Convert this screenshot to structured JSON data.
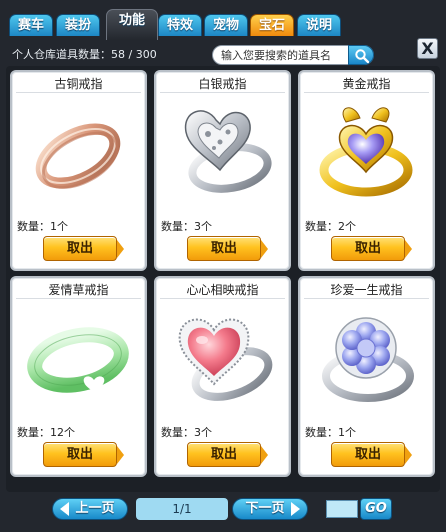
{
  "tabs": [
    {
      "label": "赛车"
    },
    {
      "label": "装扮"
    },
    {
      "label": "功能",
      "active": true
    },
    {
      "label": "特效"
    },
    {
      "label": "宠物"
    },
    {
      "label": "宝石",
      "highlight": "#f5a416"
    },
    {
      "label": "说明"
    }
  ],
  "close_label": "X",
  "header": {
    "count_label": "个人仓库道具数量：58 / 300",
    "search_placeholder": "输入您要搜索的道具名"
  },
  "items": [
    {
      "name": "古铜戒指",
      "qty": "数量：1个",
      "take_label": "取出",
      "icon": "bronze-ring-icon"
    },
    {
      "name": "白银戒指",
      "qty": "数量：3个",
      "take_label": "取出",
      "icon": "silver-heart-ring-icon"
    },
    {
      "name": "黄金戒指",
      "qty": "数量：2个",
      "take_label": "取出",
      "icon": "golden-gem-ring-icon"
    },
    {
      "name": "爱情草戒指",
      "qty": "数量：12个",
      "take_label": "取出",
      "icon": "green-heart-band-icon"
    },
    {
      "name": "心心相映戒指",
      "qty": "数量：3个",
      "take_label": "取出",
      "icon": "pink-heart-ring-icon"
    },
    {
      "name": "珍爱一生戒指",
      "qty": "数量：1个",
      "take_label": "取出",
      "icon": "blue-flower-ring-icon"
    }
  ],
  "pagination": {
    "prev_label": "上一页",
    "page": "1/1",
    "next_label": "下一页",
    "go_label": "GO"
  },
  "colors": {
    "tab_blue": "#2ea3dd",
    "tab_orange": "#f5a416",
    "panel_dark": "#23272e",
    "button_orange": "#ffc21f"
  }
}
